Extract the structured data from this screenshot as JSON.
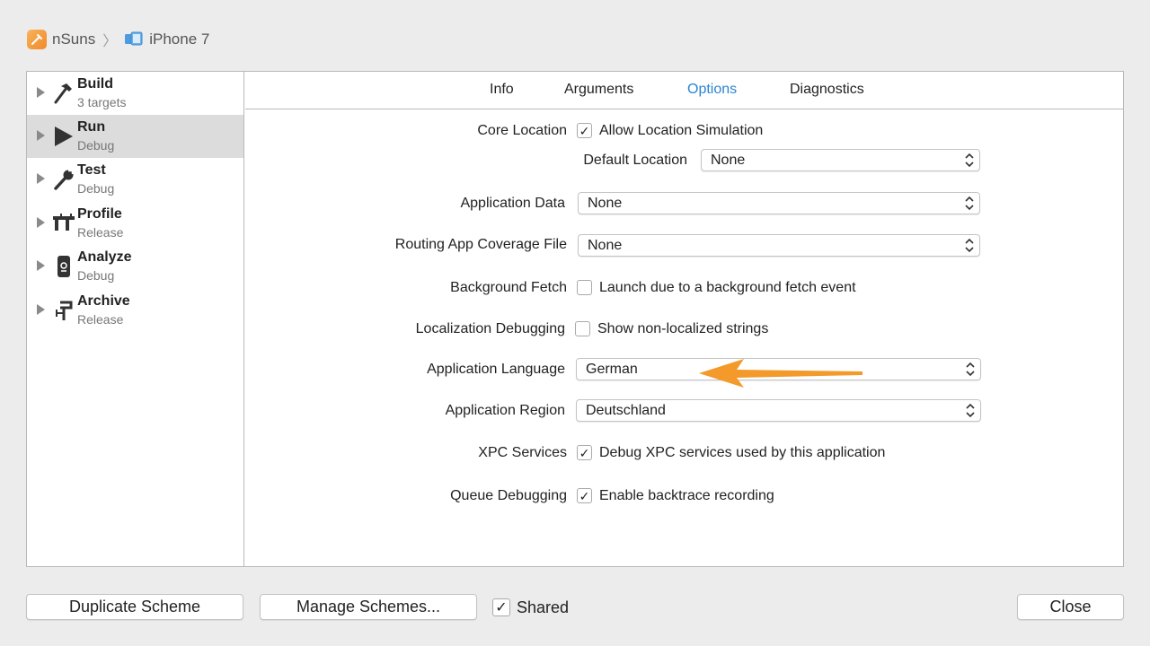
{
  "breadcrumb": {
    "project": "nSuns",
    "separator": "〉",
    "device": "iPhone 7"
  },
  "sidebar": {
    "items": [
      {
        "title": "Build",
        "subtitle": "3 targets",
        "icon": "hammer-icon"
      },
      {
        "title": "Run",
        "subtitle": "Debug",
        "icon": "play-icon",
        "selected": true
      },
      {
        "title": "Test",
        "subtitle": "Debug",
        "icon": "wrench-icon"
      },
      {
        "title": "Profile",
        "subtitle": "Release",
        "icon": "caliper-icon"
      },
      {
        "title": "Analyze",
        "subtitle": "Debug",
        "icon": "analyze-icon"
      },
      {
        "title": "Archive",
        "subtitle": "Release",
        "icon": "archive-icon"
      }
    ]
  },
  "tabs": [
    {
      "label": "Info"
    },
    {
      "label": "Arguments"
    },
    {
      "label": "Options",
      "active": true
    },
    {
      "label": "Diagnostics"
    }
  ],
  "options": {
    "core_location": {
      "label": "Core Location",
      "checkbox_label": "Allow Location Simulation",
      "checked": "✓",
      "default_location_label": "Default Location",
      "default_location_value": "None"
    },
    "application_data": {
      "label": "Application Data",
      "value": "None"
    },
    "routing_app_coverage": {
      "label": "Routing App Coverage File",
      "value": "None"
    },
    "background_fetch": {
      "label": "Background Fetch",
      "checkbox_label": "Launch due to a background fetch event",
      "checked": ""
    },
    "localization_debugging": {
      "label": "Localization Debugging",
      "checkbox_label": "Show non-localized strings",
      "checked": ""
    },
    "application_language": {
      "label": "Application Language",
      "value": "German"
    },
    "application_region": {
      "label": "Application Region",
      "value": "Deutschland"
    },
    "xpc_services": {
      "label": "XPC Services",
      "checkbox_label": "Debug XPC services used by this application",
      "checked": "✓"
    },
    "queue_debugging": {
      "label": "Queue Debugging",
      "checkbox_label": "Enable backtrace recording",
      "checked": "✓"
    }
  },
  "footer": {
    "duplicate_label": "Duplicate Scheme",
    "manage_label": "Manage Schemes...",
    "shared_label": "Shared",
    "shared_checked": "✓",
    "close_label": "Close"
  },
  "colors": {
    "accent": "#2a84d2",
    "annotation_arrow": "#f39a2b"
  }
}
